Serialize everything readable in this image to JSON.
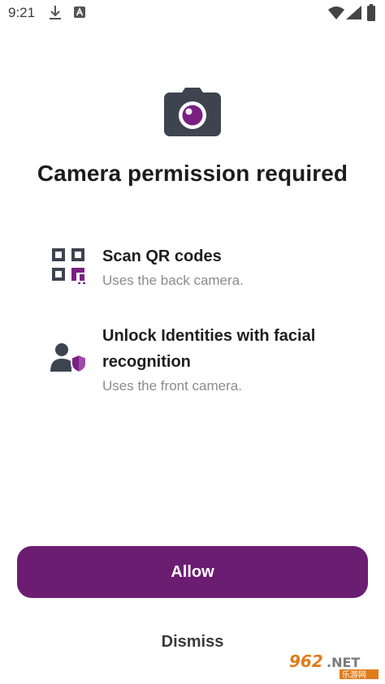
{
  "status_bar": {
    "time": "9:21",
    "icons": [
      "download-icon",
      "a-icon",
      "wifi-icon",
      "signal-icon",
      "battery-icon"
    ]
  },
  "hero": {
    "icon": "camera-icon"
  },
  "title": "Camera permission required",
  "features": [
    {
      "icon": "qr-code-icon",
      "title": "Scan QR codes",
      "subtitle": "Uses the back camera."
    },
    {
      "icon": "user-shield-icon",
      "title": "Unlock Identities with facial recognition",
      "subtitle": "Uses the front camera."
    }
  ],
  "actions": {
    "allow_label": "Allow",
    "dismiss_label": "Dismiss"
  },
  "watermark": {
    "text_top": "962.NET",
    "text_bottom": "乐游网"
  },
  "colors": {
    "accent": "#6b1d72",
    "icon_dark": "#3d4450",
    "subtitle_gray": "#8b8b8b"
  }
}
